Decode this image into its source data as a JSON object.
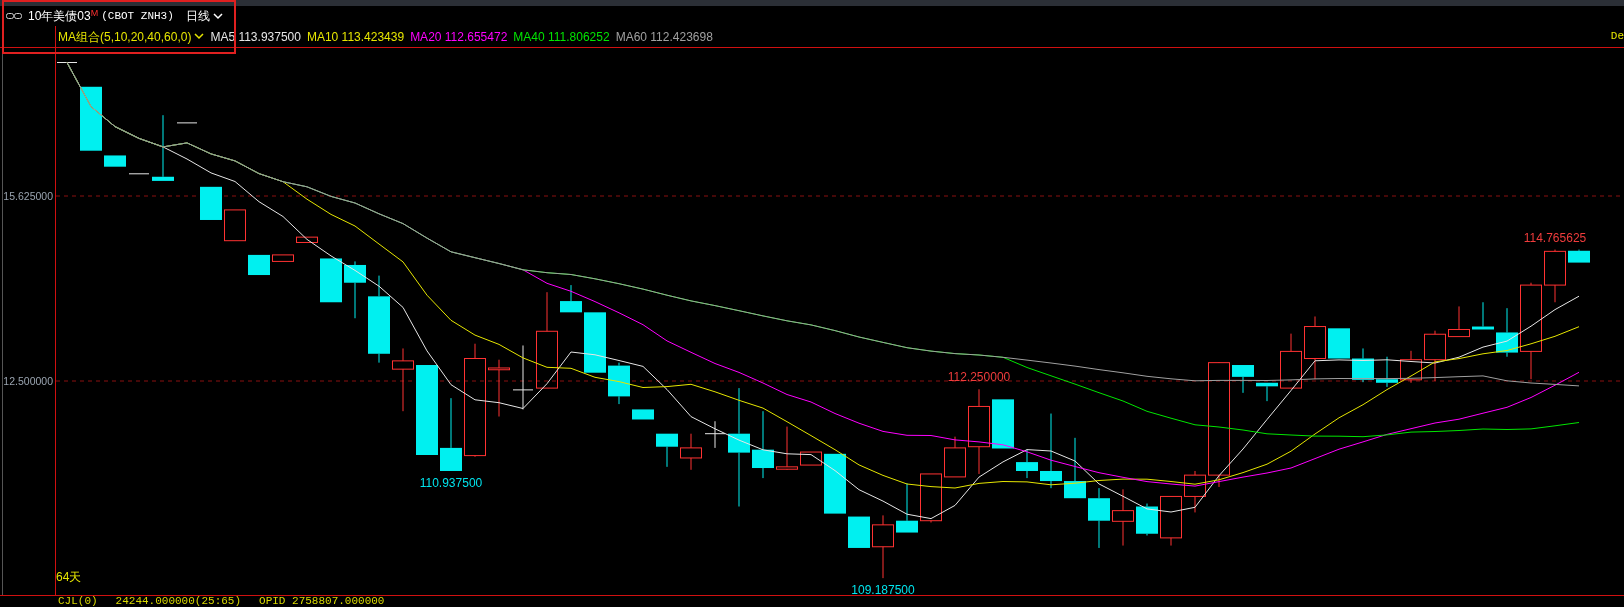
{
  "header": {
    "title": "10年美债03$^{M}$",
    "code": "(CBOT ZNH3)",
    "period": "日线"
  },
  "legend": {
    "group": "MA组合(5,10,20,40,60,0)",
    "items": [
      {
        "label": "MA5 113.937500",
        "color": "#e6e6e6"
      },
      {
        "label": "MA10 113.423439",
        "color": "#e6e600"
      },
      {
        "label": "MA20 112.655472",
        "color": "#ff00ff"
      },
      {
        "label": "MA40 111.806252",
        "color": "#00e600"
      },
      {
        "label": "MA60 112.423698",
        "color": "#a0a0a0"
      }
    ],
    "right_text": "De"
  },
  "chart": {
    "axis_labels": [
      "15.625000",
      "12.500000"
    ],
    "price_labels": [
      {
        "text": "110.937500",
        "color": "#00e5ee"
      },
      {
        "text": "112.250000",
        "color": "#f03c3c"
      },
      {
        "text": "109.187500",
        "color": "#00e5ee"
      },
      {
        "text": "114.765625",
        "color": "#f03c3c"
      }
    ],
    "span_label": "64天"
  },
  "footer": [
    "CJL(0)",
    "24244.000000(25:65)",
    "OPID 2758807.000000"
  ]
}
